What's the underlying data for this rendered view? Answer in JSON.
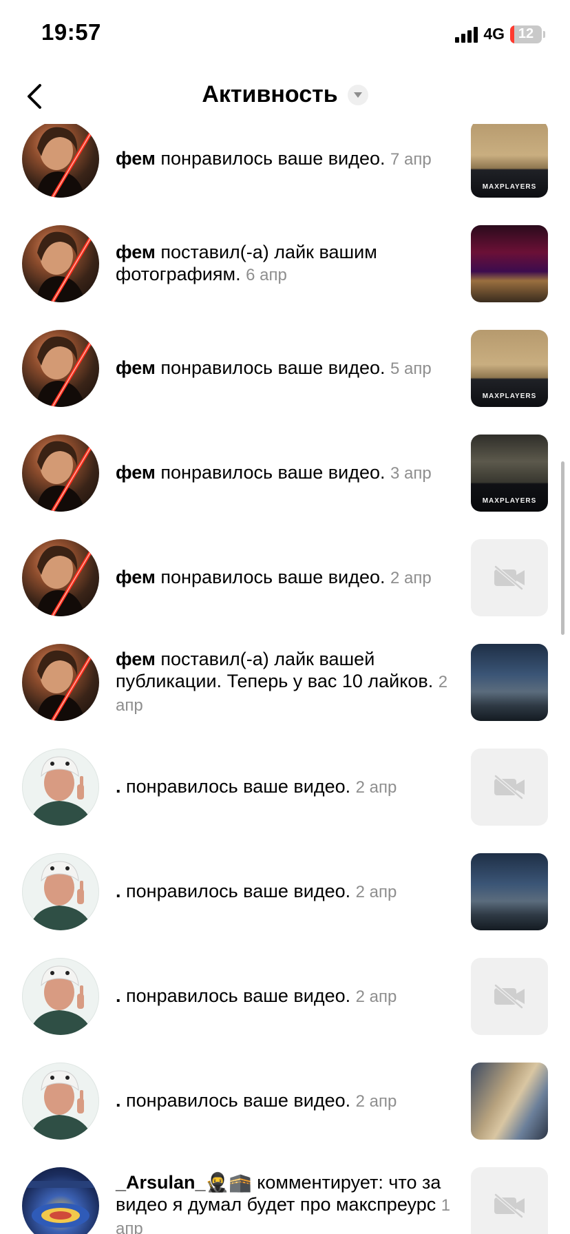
{
  "status_bar": {
    "time": "19:57",
    "network": "4G",
    "battery_level": "12",
    "battery_fraction": 0.12
  },
  "nav": {
    "title": "Активность"
  },
  "thumb_logo_text": "MAXPLAYERS",
  "activity": [
    {
      "user": "фем",
      "action": " понравилось ваше видео.",
      "date": "7 апр",
      "avatar": "anakin",
      "thumb": "cs"
    },
    {
      "user": "фем",
      "action": " поставил(-а) лайк вашим фотографиям.",
      "date": "6 апр",
      "avatar": "anakin",
      "thumb": "red"
    },
    {
      "user": "фем",
      "action": " понравилось ваше видео.",
      "date": "5 апр",
      "avatar": "anakin",
      "thumb": "cs"
    },
    {
      "user": "фем",
      "action": " понравилось ваше видео.",
      "date": "3 апр",
      "avatar": "anakin",
      "thumb": "cs-dark"
    },
    {
      "user": "фем",
      "action": " понравилось ваше видео.",
      "date": "2 апр",
      "avatar": "anakin",
      "thumb": "placeholder"
    },
    {
      "user": "фем",
      "action": " поставил(-а) лайк вашей публикации. Теперь у вас 10 лайков.",
      "date": "2 апр",
      "avatar": "anakin",
      "thumb": "night"
    },
    {
      "user": ".",
      "action": " понравилось ваше видео.",
      "date": "2 апр",
      "avatar": "old",
      "thumb": "placeholder"
    },
    {
      "user": ".",
      "action": " понравилось ваше видео.",
      "date": "2 апр",
      "avatar": "old",
      "thumb": "night"
    },
    {
      "user": ".",
      "action": " понравилось ваше видео.",
      "date": "2 апр",
      "avatar": "old",
      "thumb": "placeholder"
    },
    {
      "user": ".",
      "action": " понравилось ваше видео.",
      "date": "2 апр",
      "avatar": "old",
      "thumb": "blur"
    },
    {
      "user": "_Arsulan_🥷🕋",
      "action": " комментирует: что за видео я думал будет про макспреурс",
      "date": "1 апр",
      "avatar": "arena",
      "thumb": "placeholder"
    }
  ],
  "colors": {
    "muted": "#8e8e8e",
    "placeholder_bg": "#f0f0f0",
    "battery_low": "#ff3b30"
  }
}
